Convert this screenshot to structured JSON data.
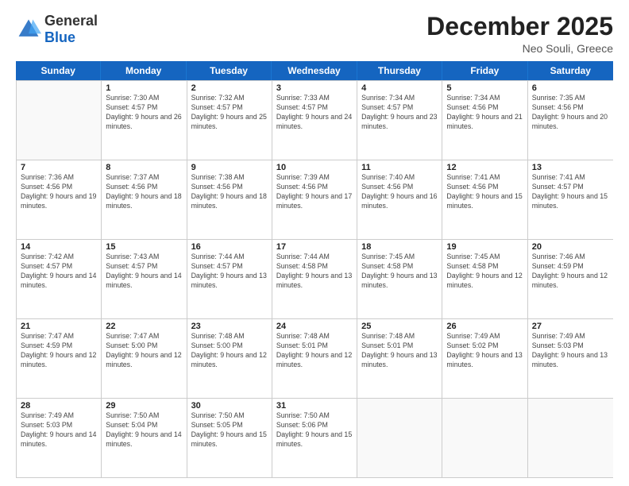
{
  "logo": {
    "general": "General",
    "blue": "Blue"
  },
  "title": "December 2025",
  "location": "Neo Souli, Greece",
  "weekdays": [
    "Sunday",
    "Monday",
    "Tuesday",
    "Wednesday",
    "Thursday",
    "Friday",
    "Saturday"
  ],
  "weeks": [
    [
      {
        "day": "",
        "sunrise": "",
        "sunset": "",
        "daylight": ""
      },
      {
        "day": "1",
        "sunrise": "7:30 AM",
        "sunset": "4:57 PM",
        "daylight": "9 hours and 26 minutes."
      },
      {
        "day": "2",
        "sunrise": "7:32 AM",
        "sunset": "4:57 PM",
        "daylight": "9 hours and 25 minutes."
      },
      {
        "day": "3",
        "sunrise": "7:33 AM",
        "sunset": "4:57 PM",
        "daylight": "9 hours and 24 minutes."
      },
      {
        "day": "4",
        "sunrise": "7:34 AM",
        "sunset": "4:57 PM",
        "daylight": "9 hours and 23 minutes."
      },
      {
        "day": "5",
        "sunrise": "7:34 AM",
        "sunset": "4:56 PM",
        "daylight": "9 hours and 21 minutes."
      },
      {
        "day": "6",
        "sunrise": "7:35 AM",
        "sunset": "4:56 PM",
        "daylight": "9 hours and 20 minutes."
      }
    ],
    [
      {
        "day": "7",
        "sunrise": "7:36 AM",
        "sunset": "4:56 PM",
        "daylight": "9 hours and 19 minutes."
      },
      {
        "day": "8",
        "sunrise": "7:37 AM",
        "sunset": "4:56 PM",
        "daylight": "9 hours and 18 minutes."
      },
      {
        "day": "9",
        "sunrise": "7:38 AM",
        "sunset": "4:56 PM",
        "daylight": "9 hours and 18 minutes."
      },
      {
        "day": "10",
        "sunrise": "7:39 AM",
        "sunset": "4:56 PM",
        "daylight": "9 hours and 17 minutes."
      },
      {
        "day": "11",
        "sunrise": "7:40 AM",
        "sunset": "4:56 PM",
        "daylight": "9 hours and 16 minutes."
      },
      {
        "day": "12",
        "sunrise": "7:41 AM",
        "sunset": "4:56 PM",
        "daylight": "9 hours and 15 minutes."
      },
      {
        "day": "13",
        "sunrise": "7:41 AM",
        "sunset": "4:57 PM",
        "daylight": "9 hours and 15 minutes."
      }
    ],
    [
      {
        "day": "14",
        "sunrise": "7:42 AM",
        "sunset": "4:57 PM",
        "daylight": "9 hours and 14 minutes."
      },
      {
        "day": "15",
        "sunrise": "7:43 AM",
        "sunset": "4:57 PM",
        "daylight": "9 hours and 14 minutes."
      },
      {
        "day": "16",
        "sunrise": "7:44 AM",
        "sunset": "4:57 PM",
        "daylight": "9 hours and 13 minutes."
      },
      {
        "day": "17",
        "sunrise": "7:44 AM",
        "sunset": "4:58 PM",
        "daylight": "9 hours and 13 minutes."
      },
      {
        "day": "18",
        "sunrise": "7:45 AM",
        "sunset": "4:58 PM",
        "daylight": "9 hours and 13 minutes."
      },
      {
        "day": "19",
        "sunrise": "7:45 AM",
        "sunset": "4:58 PM",
        "daylight": "9 hours and 12 minutes."
      },
      {
        "day": "20",
        "sunrise": "7:46 AM",
        "sunset": "4:59 PM",
        "daylight": "9 hours and 12 minutes."
      }
    ],
    [
      {
        "day": "21",
        "sunrise": "7:47 AM",
        "sunset": "4:59 PM",
        "daylight": "9 hours and 12 minutes."
      },
      {
        "day": "22",
        "sunrise": "7:47 AM",
        "sunset": "5:00 PM",
        "daylight": "9 hours and 12 minutes."
      },
      {
        "day": "23",
        "sunrise": "7:48 AM",
        "sunset": "5:00 PM",
        "daylight": "9 hours and 12 minutes."
      },
      {
        "day": "24",
        "sunrise": "7:48 AM",
        "sunset": "5:01 PM",
        "daylight": "9 hours and 12 minutes."
      },
      {
        "day": "25",
        "sunrise": "7:48 AM",
        "sunset": "5:01 PM",
        "daylight": "9 hours and 13 minutes."
      },
      {
        "day": "26",
        "sunrise": "7:49 AM",
        "sunset": "5:02 PM",
        "daylight": "9 hours and 13 minutes."
      },
      {
        "day": "27",
        "sunrise": "7:49 AM",
        "sunset": "5:03 PM",
        "daylight": "9 hours and 13 minutes."
      }
    ],
    [
      {
        "day": "28",
        "sunrise": "7:49 AM",
        "sunset": "5:03 PM",
        "daylight": "9 hours and 14 minutes."
      },
      {
        "day": "29",
        "sunrise": "7:50 AM",
        "sunset": "5:04 PM",
        "daylight": "9 hours and 14 minutes."
      },
      {
        "day": "30",
        "sunrise": "7:50 AM",
        "sunset": "5:05 PM",
        "daylight": "9 hours and 15 minutes."
      },
      {
        "day": "31",
        "sunrise": "7:50 AM",
        "sunset": "5:06 PM",
        "daylight": "9 hours and 15 minutes."
      },
      {
        "day": "",
        "sunrise": "",
        "sunset": "",
        "daylight": ""
      },
      {
        "day": "",
        "sunrise": "",
        "sunset": "",
        "daylight": ""
      },
      {
        "day": "",
        "sunrise": "",
        "sunset": "",
        "daylight": ""
      }
    ]
  ]
}
